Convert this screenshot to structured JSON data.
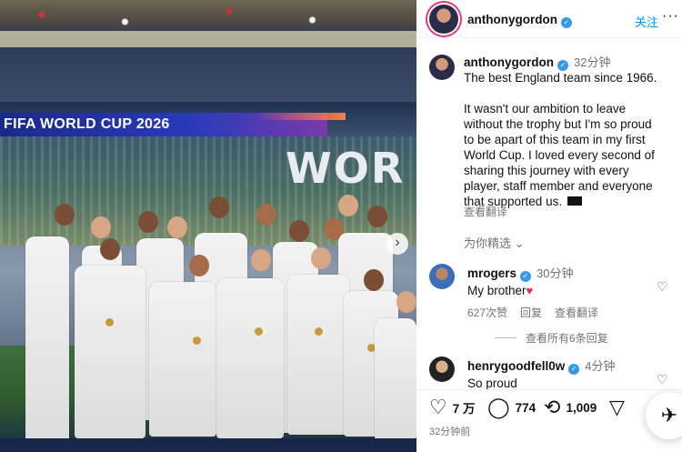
{
  "photo": {
    "ribbon_text": "FIFA WORLD CUP 2026",
    "world_text": "WOR",
    "next_icon": "chevron-right-icon"
  },
  "post": {
    "author": "anthonygordon",
    "follow_label": "关注",
    "more_label": "···"
  },
  "caption": {
    "author": "anthonygordon",
    "time": "32分钟",
    "lines": [
      "The best England team since 1966.",
      "",
      "It wasn't our ambition to leave",
      "without the trophy but I'm so proud",
      "to be apart of this team in my first",
      "World Cup. I loved every second of",
      "sharing this journey with every",
      "player, staff member and everyone",
      "that supported us."
    ],
    "translate_label": "查看翻译",
    "related_label": "为你精选 ⌄"
  },
  "comments": [
    {
      "author": "mrogers",
      "time": "30分钟",
      "text": "My brother",
      "heart": "♥",
      "likes": "627次赞",
      "reply_label": "回复",
      "translate_label": "查看翻译"
    },
    {
      "author": "henrygoodfell0w",
      "time": "4分钟",
      "text": "So proud"
    }
  ],
  "view_replies_label": "查看所有6条回复",
  "actions": {
    "likes": "7 万",
    "comments": "774",
    "shares": "1,009",
    "time_ago": "32分钟前"
  },
  "colors": {
    "accent": "#0095f6",
    "verified": "#3797f0",
    "heart": "#ed2b4e",
    "muted": "#737373"
  }
}
